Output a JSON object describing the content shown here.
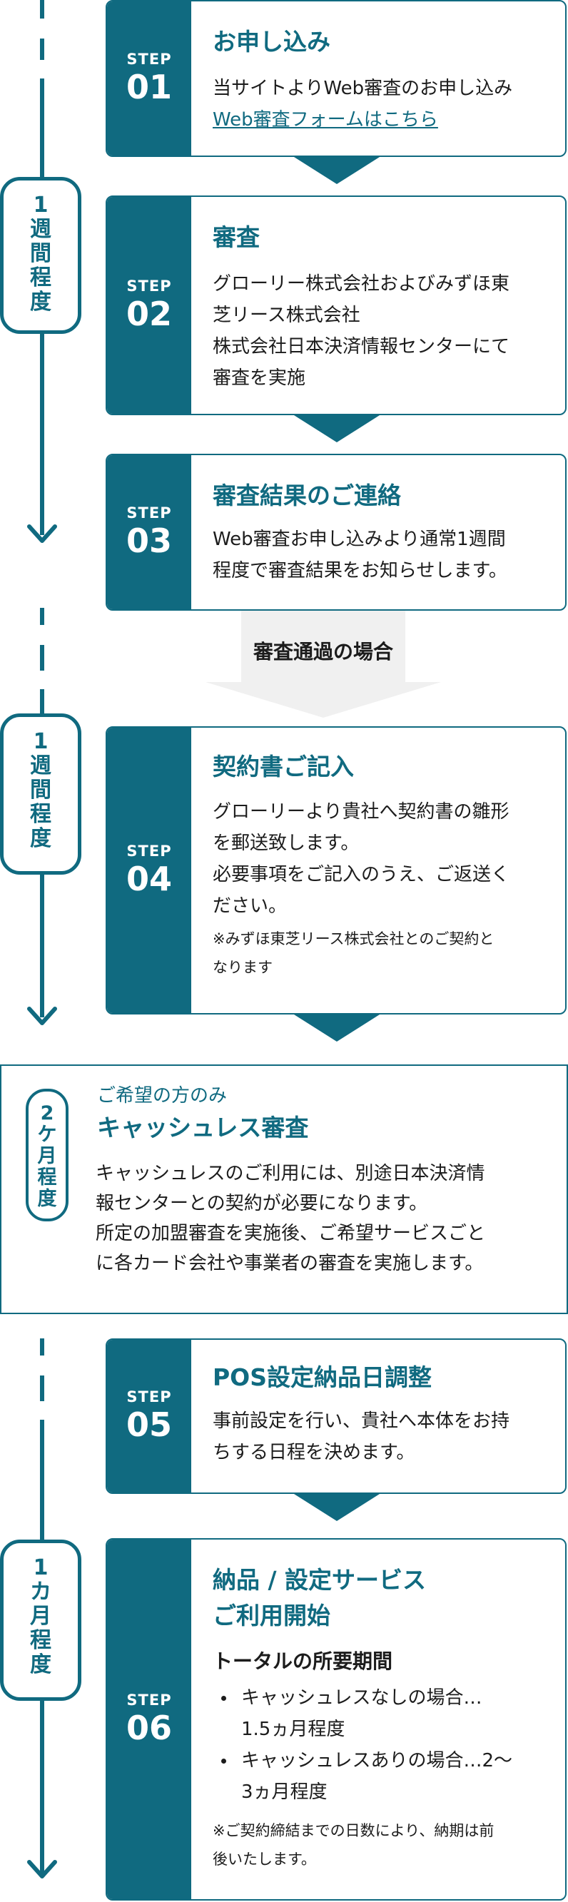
{
  "colors": {
    "accent": "#106a80",
    "gray": "#f0f0f0",
    "text": "#1c1c1c"
  },
  "durations": {
    "d1": [
      "1",
      "週",
      "間",
      "程",
      "度"
    ],
    "d2": [
      "1",
      "週",
      "間",
      "程",
      "度"
    ],
    "d3": [
      "2",
      "ケ",
      "月",
      "程",
      "度"
    ],
    "d4": [
      "1",
      "カ",
      "月",
      "程",
      "度"
    ]
  },
  "steps": {
    "s01": {
      "label": "STEP",
      "num": "01",
      "title": "お申し込み",
      "body": "当サイトよりWeb審査のお申し込み",
      "link": "Web審査フォームはこちら"
    },
    "s02": {
      "label": "STEP",
      "num": "02",
      "title": "審査",
      "lines": [
        "グローリー株式会社およびみずほ東",
        "芝リース株式会社",
        "株式会社日本決済情報センターにて",
        "審査を実施"
      ]
    },
    "s03": {
      "label": "STEP",
      "num": "03",
      "title": "審査結果のご連絡",
      "lines": [
        "Web審査お申し込みより通常1週間",
        "程度で審査結果をお知らせします。"
      ]
    },
    "pass": "審査通過の場合",
    "s04": {
      "label": "STEP",
      "num": "04",
      "title": "契約書ご記入",
      "lines": [
        "グローリーより貴社へ契約書の雛形",
        "を郵送致します。",
        "必要事項をご記入のうえ、ご返送く",
        "ださい。"
      ],
      "notes": [
        "※みずほ東芝リース株式会社とのご契約と",
        "なります"
      ]
    },
    "cashless": {
      "sub": "ご希望の方のみ",
      "title": "キャッシュレス審査",
      "lines": [
        "キャッシュレスのご利用には、別途日本決済情",
        "報センターとの契約が必要になります。",
        "所定の加盟審査を実施後、ご希望サービスごと",
        "に各カード会社や事業者の審査を実施します。"
      ]
    },
    "s05": {
      "label": "STEP",
      "num": "05",
      "title": "POS設定納品日調整",
      "lines": [
        "事前設定を行い、貴社へ本体をお持",
        "ちする日程を決めます。"
      ]
    },
    "s06": {
      "label": "STEP",
      "num": "06",
      "title_lines": [
        "納品 / 設定サービス",
        "ご利用開始"
      ],
      "subtitle": "トータルの所要期間",
      "bullets": [
        [
          "キャッシュレスなしの場合…",
          "1.5ヵ月程度"
        ],
        [
          "キャッシュレスありの場合…2〜",
          "3ヵ月程度"
        ]
      ],
      "notes": [
        "※ご契約締結までの日数により、納期は前",
        "後いたします。"
      ]
    }
  }
}
